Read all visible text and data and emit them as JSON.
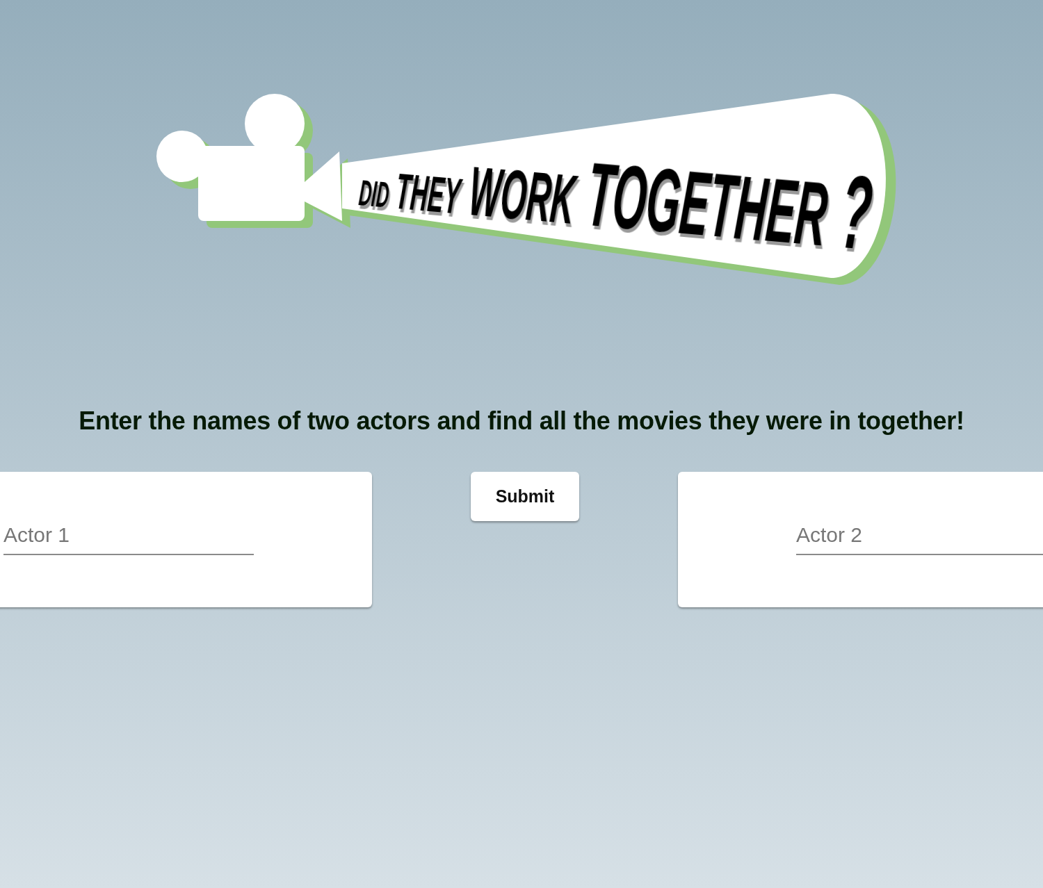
{
  "logo": {
    "title": "DID THEY WORK TOGETHER ?"
  },
  "tagline": "Enter the names of two actors and find all the movies they were in together!",
  "actor_fields": [
    {
      "placeholder": "Actor 1"
    },
    {
      "placeholder": "Actor 2"
    }
  ],
  "submit_button": {
    "label": "Submit"
  }
}
